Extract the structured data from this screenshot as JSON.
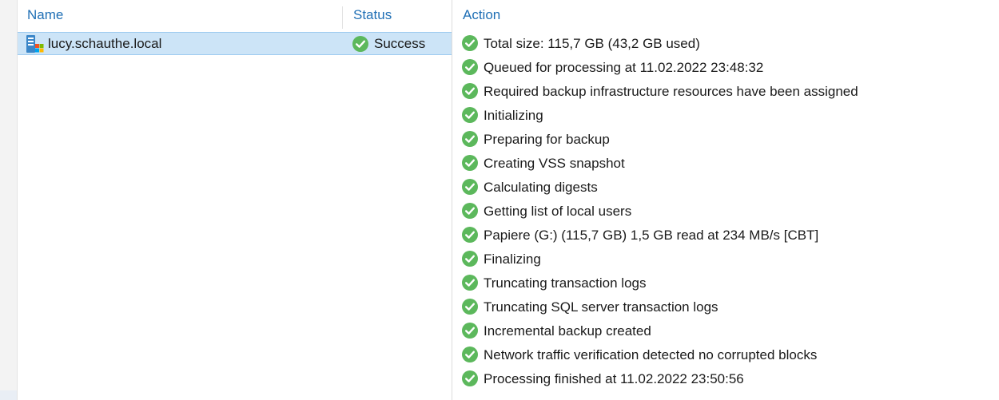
{
  "columns": {
    "name": "Name",
    "status": "Status",
    "action": "Action"
  },
  "session": {
    "name": "lucy.schauthe.local",
    "status": "Success",
    "icon": "windows-server-icon",
    "status_icon": "success-check-icon",
    "selected": true
  },
  "colors": {
    "header_text": "#1f6fb5",
    "selection": "#cce4f7",
    "success_green": "#5cb85c"
  },
  "actions": [
    {
      "text": "Total size: 115,7 GB (43,2 GB used)",
      "icon": "success-check-icon"
    },
    {
      "text": "Queued for processing at 11.02.2022 23:48:32",
      "icon": "success-check-icon"
    },
    {
      "text": "Required backup infrastructure resources have been assigned",
      "icon": "success-check-icon"
    },
    {
      "text": "Initializing",
      "icon": "success-check-icon"
    },
    {
      "text": "Preparing for backup",
      "icon": "success-check-icon"
    },
    {
      "text": "Creating VSS snapshot",
      "icon": "success-check-icon"
    },
    {
      "text": "Calculating digests",
      "icon": "success-check-icon"
    },
    {
      "text": "Getting list of local users",
      "icon": "success-check-icon"
    },
    {
      "text": "Papiere (G:) (115,7 GB) 1,5 GB read at 234 MB/s [CBT]",
      "icon": "success-check-icon"
    },
    {
      "text": "Finalizing",
      "icon": "success-check-icon"
    },
    {
      "text": "Truncating transaction logs",
      "icon": "success-check-icon"
    },
    {
      "text": "Truncating SQL server transaction logs",
      "icon": "success-check-icon"
    },
    {
      "text": "Incremental backup created",
      "icon": "success-check-icon"
    },
    {
      "text": "Network traffic verification detected no corrupted blocks",
      "icon": "success-check-icon"
    },
    {
      "text": "Processing finished at 11.02.2022 23:50:56",
      "icon": "success-check-icon"
    }
  ]
}
